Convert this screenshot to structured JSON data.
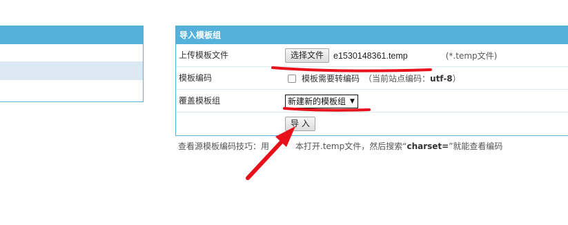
{
  "panel": {
    "title": "导入模板组"
  },
  "upload": {
    "label": "上传模板文件",
    "button_label": "选择文件",
    "file_name": "e1530148361.temp",
    "hint": "(*.temp文件)"
  },
  "encoding": {
    "label": "模板编码",
    "checkbox_label": "模板需要转编码",
    "checked": false,
    "note_prefix": "（当前站点编码：",
    "note_value": "utf-8",
    "note_suffix": "）"
  },
  "overwrite": {
    "label": "覆盖模板组",
    "selected": "新建新的模板组"
  },
  "import_button": {
    "label": "导 入"
  },
  "help": {
    "prefix": "查看源模板编码技巧：用",
    "middle": "本打开.temp文件，然后搜索“",
    "keyword": "charset=",
    "suffix": "”就能查看编码"
  },
  "colors": {
    "panel_header": "#53b1da",
    "row_alt": "#dce9f4",
    "annotation": "#e8101a"
  }
}
